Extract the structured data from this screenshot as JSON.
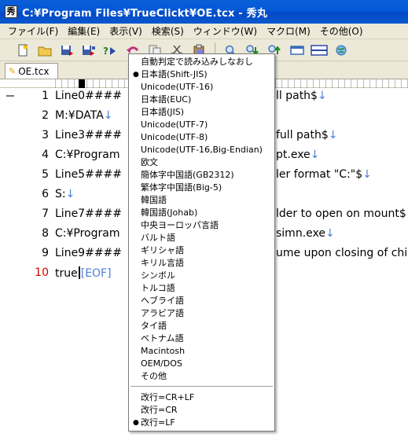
{
  "window": {
    "title": "C:¥Program Files¥TrueClickt¥OE.tcx - 秀丸"
  },
  "menubar": [
    "ファイル(F)",
    "編集(E)",
    "表示(V)",
    "検索(S)",
    "ウィンドウ(W)",
    "マクロ(M)",
    "その他(O)"
  ],
  "toolbar": {
    "icons": [
      "new-file-icon",
      "open-folder-icon",
      "save-icon",
      "save-as-icon",
      "encoding-icon",
      "undo-icon",
      "copy-icon",
      "cut-icon",
      "paste-icon",
      "search-icon",
      "search-down-icon",
      "search-up-icon",
      "window-icon",
      "split-icon",
      "globe-icon"
    ]
  },
  "tab": {
    "label": "OE.tcx"
  },
  "editor": {
    "lines": [
      {
        "num": "1",
        "left": "Line0####",
        "right": "ll path$",
        "nl": "↓"
      },
      {
        "num": "2",
        "left": "M:¥DATA",
        "right": "",
        "nl": "↓"
      },
      {
        "num": "3",
        "left": "Line3####",
        "right": "full path$",
        "nl": "↓"
      },
      {
        "num": "4",
        "left": "C:¥Program",
        "right": "pt.exe",
        "nl": "↓"
      },
      {
        "num": "5",
        "left": "Line5####",
        "right": "ler format \"C:\"$",
        "nl": "↓"
      },
      {
        "num": "6",
        "left": "S:",
        "right": "",
        "nl": "↓"
      },
      {
        "num": "7",
        "left": "Line7####",
        "right": "lder to open on mount$",
        "nl": ""
      },
      {
        "num": "8",
        "left": "C:¥Program",
        "right": "simn.exe",
        "nl": "↓"
      },
      {
        "num": "9",
        "left": "Line9####",
        "right": "ume upon closing of chil",
        "nl": ""
      },
      {
        "num": "10",
        "left": "true",
        "right": "",
        "nl": "",
        "eof": "[EOF]"
      }
    ]
  },
  "encoding_menu": {
    "items": [
      {
        "label": "自動判定で読み込みしなおし",
        "selected": false
      },
      {
        "label": "日本語(Shift-JIS)",
        "selected": true
      },
      {
        "label": "Unicode(UTF-16)",
        "selected": false
      },
      {
        "label": "日本語(EUC)",
        "selected": false
      },
      {
        "label": "日本語(JIS)",
        "selected": false
      },
      {
        "label": "Unicode(UTF-7)",
        "selected": false
      },
      {
        "label": "Unicode(UTF-8)",
        "selected": false
      },
      {
        "label": "Unicode(UTF-16,Big-Endian)",
        "selected": false
      },
      {
        "label": "欧文",
        "selected": false
      },
      {
        "label": "簡体字中国語(GB2312)",
        "selected": false
      },
      {
        "label": "繁体字中国語(Big-5)",
        "selected": false
      },
      {
        "label": "韓国語",
        "selected": false
      },
      {
        "label": "韓国語(Johab)",
        "selected": false
      },
      {
        "label": "中央ヨーロッパ言語",
        "selected": false
      },
      {
        "label": "バルト語",
        "selected": false
      },
      {
        "label": "ギリシャ語",
        "selected": false
      },
      {
        "label": "キリル言語",
        "selected": false
      },
      {
        "label": "シンボル",
        "selected": false
      },
      {
        "label": "トルコ語",
        "selected": false
      },
      {
        "label": "ヘブライ語",
        "selected": false
      },
      {
        "label": "アラビア語",
        "selected": false
      },
      {
        "label": "タイ語",
        "selected": false
      },
      {
        "label": "ベトナム語",
        "selected": false
      },
      {
        "label": "Macintosh",
        "selected": false
      },
      {
        "label": "OEM/DOS",
        "selected": false
      },
      {
        "label": "その他",
        "selected": false
      }
    ],
    "newline_items": [
      {
        "label": "改行=CR+LF",
        "selected": false
      },
      {
        "label": "改行=CR",
        "selected": false
      },
      {
        "label": "改行=LF",
        "selected": true
      }
    ],
    "bullet": "●"
  },
  "colors": {
    "titlebar": "#0458d8",
    "current_line_number": "#d00000",
    "newline_mark": "#4a7fd6"
  }
}
